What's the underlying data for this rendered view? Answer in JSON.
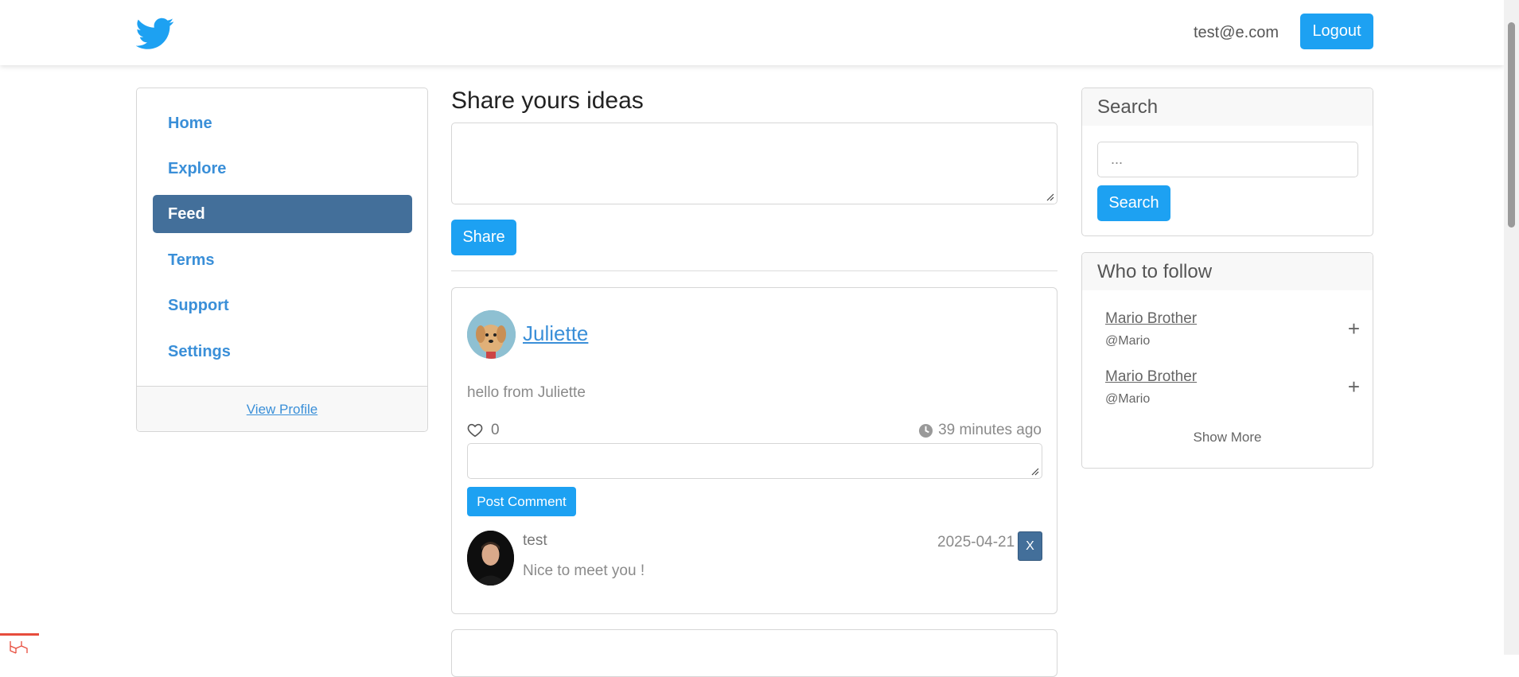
{
  "header": {
    "logo_icon": "twitter-bird-icon",
    "user_email": "test@e.com",
    "logout_label": "Logout"
  },
  "sidebar": {
    "items": [
      {
        "label": "Home",
        "active": false
      },
      {
        "label": "Explore",
        "active": false
      },
      {
        "label": "Feed",
        "active": true
      },
      {
        "label": "Terms",
        "active": false
      },
      {
        "label": "Support",
        "active": false
      },
      {
        "label": "Settings",
        "active": false
      }
    ],
    "view_profile_label": "View Profile"
  },
  "composer": {
    "title": "Share yours ideas",
    "textarea_value": "",
    "share_label": "Share"
  },
  "post": {
    "author": "Juliette",
    "content": "hello from Juliette",
    "likes": "0",
    "time_ago": "39 minutes ago",
    "comment_input_value": "",
    "post_comment_label": "Post Comment",
    "comment": {
      "user": "test",
      "text": "Nice to meet you !",
      "date": "2025-04-21",
      "delete_label": "X"
    }
  },
  "search_panel": {
    "title": "Search",
    "placeholder": "...",
    "button_label": "Search"
  },
  "follow_panel": {
    "title": "Who to follow",
    "items": [
      {
        "name": "Mario Brother",
        "handle": "@Mario",
        "action": "+"
      },
      {
        "name": "Mario Brother",
        "handle": "@Mario",
        "action": "+"
      }
    ],
    "show_more_label": "Show More"
  },
  "colors": {
    "accent": "#1da1f2",
    "active_nav": "#436f9a",
    "link": "#3a8fd8"
  }
}
